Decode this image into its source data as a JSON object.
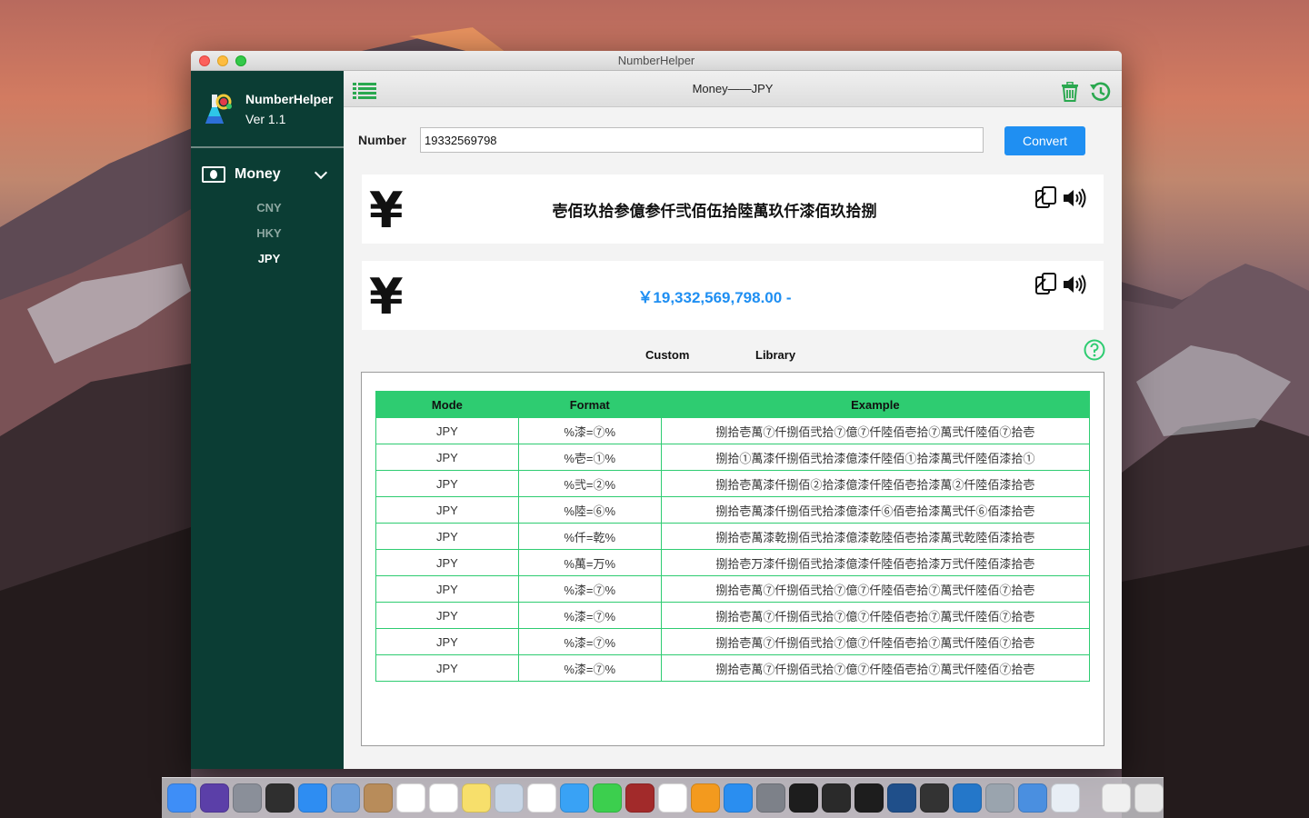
{
  "window": {
    "title": "NumberHelper"
  },
  "sidebar": {
    "app_name": "NumberHelper",
    "version": "Ver 1.1",
    "section_label": "Money",
    "items": [
      {
        "label": "CNY",
        "active": false
      },
      {
        "label": "HKY",
        "active": false
      },
      {
        "label": "JPY",
        "active": true
      }
    ]
  },
  "toolbar": {
    "title": "Money——JPY"
  },
  "form": {
    "number_label": "Number",
    "number_value": "19332569798",
    "convert_label": "Convert"
  },
  "results": {
    "currency_symbol": "¥",
    "text_result": "壱佰玖拾参億参仟弐佰伍拾陸萬玖仟漆佰玖拾捌",
    "numeric_result": "￥19,332,569,798.00 -"
  },
  "tabs": {
    "custom": "Custom",
    "library": "Library"
  },
  "table": {
    "headers": [
      "Mode",
      "Format",
      "Example"
    ],
    "rows": [
      [
        "JPY",
        "%漆=⑦%",
        "捌拾壱萬⑦仟捌佰弐拾⑦億⑦仟陸佰壱拾⑦萬弐仟陸佰⑦拾壱"
      ],
      [
        "JPY",
        "%壱=①%",
        "捌拾①萬漆仟捌佰弐拾漆億漆仟陸佰①拾漆萬弐仟陸佰漆拾①"
      ],
      [
        "JPY",
        "%弐=②%",
        "捌拾壱萬漆仟捌佰②拾漆億漆仟陸佰壱拾漆萬②仟陸佰漆拾壱"
      ],
      [
        "JPY",
        "%陸=⑥%",
        "捌拾壱萬漆仟捌佰弐拾漆億漆仟⑥佰壱拾漆萬弐仟⑥佰漆拾壱"
      ],
      [
        "JPY",
        "%仟=乾%",
        "捌拾壱萬漆乾捌佰弐拾漆億漆乾陸佰壱拾漆萬弐乾陸佰漆拾壱"
      ],
      [
        "JPY",
        "%萬=万%",
        "捌拾壱万漆仟捌佰弐拾漆億漆仟陸佰壱拾漆万弐仟陸佰漆拾壱"
      ],
      [
        "JPY",
        "%漆=⑦%",
        "捌拾壱萬⑦仟捌佰弐拾⑦億⑦仟陸佰壱拾⑦萬弐仟陸佰⑦拾壱"
      ],
      [
        "JPY",
        "%漆=⑦%",
        "捌拾壱萬⑦仟捌佰弐拾⑦億⑦仟陸佰壱拾⑦萬弐仟陸佰⑦拾壱"
      ],
      [
        "JPY",
        "%漆=⑦%",
        "捌拾壱萬⑦仟捌佰弐拾⑦億⑦仟陸佰壱拾⑦萬弐仟陸佰⑦拾壱"
      ],
      [
        "JPY",
        "%漆=⑦%",
        "捌拾壱萬⑦仟捌佰弐拾⑦億⑦仟陸佰壱拾⑦萬弐仟陸佰⑦拾壱"
      ]
    ]
  },
  "dock": {
    "apps": [
      {
        "icon": "finder-icon",
        "color": "#3e8ef7"
      },
      {
        "icon": "siri-icon",
        "color": "#5b3fa8"
      },
      {
        "icon": "launchpad-icon",
        "color": "#8a8f99"
      },
      {
        "icon": "mission-control-icon",
        "color": "#2f2f2f"
      },
      {
        "icon": "safari-icon",
        "color": "#2e8df2"
      },
      {
        "icon": "preview-icon",
        "color": "#6f9fd8"
      },
      {
        "icon": "contacts-icon",
        "color": "#b88c5a"
      },
      {
        "icon": "calendar-icon",
        "color": "#ffffff"
      },
      {
        "icon": "reminders-icon",
        "color": "#ffffff"
      },
      {
        "icon": "notes-icon",
        "color": "#f7df6b"
      },
      {
        "icon": "image-capture-icon",
        "color": "#c8d6e6"
      },
      {
        "icon": "photos-icon",
        "color": "#ffffff"
      },
      {
        "icon": "messages-icon",
        "color": "#39a2f5"
      },
      {
        "icon": "facetime-icon",
        "color": "#3ccf4e"
      },
      {
        "icon": "photo-booth-icon",
        "color": "#a22a2a"
      },
      {
        "icon": "itunes-icon",
        "color": "#ffffff"
      },
      {
        "icon": "ibooks-icon",
        "color": "#f39a1e"
      },
      {
        "icon": "app-store-icon",
        "color": "#2a8ef0"
      },
      {
        "icon": "system-preferences-icon",
        "color": "#7d8189"
      },
      {
        "icon": "terminal-icon",
        "color": "#1d1d1d"
      },
      {
        "icon": "console-icon",
        "color": "#2a2a2a"
      },
      {
        "icon": "activity-monitor-icon",
        "color": "#1d1d1d"
      },
      {
        "icon": "sourcetree-icon",
        "color": "#1f4f8a"
      },
      {
        "icon": "dvd-player-icon",
        "color": "#333333"
      },
      {
        "icon": "vscode-icon",
        "color": "#2477c9"
      },
      {
        "icon": "preview2-icon",
        "color": "#9aa4ae"
      },
      {
        "icon": "xcode-icon",
        "color": "#4a8fe0"
      },
      {
        "icon": "numberhelper-icon",
        "color": "#e8eef5"
      }
    ],
    "others": [
      {
        "icon": "documents-icon",
        "color": "#f0f0f0"
      },
      {
        "icon": "trash-icon",
        "color": "#e8e8e8"
      }
    ]
  }
}
